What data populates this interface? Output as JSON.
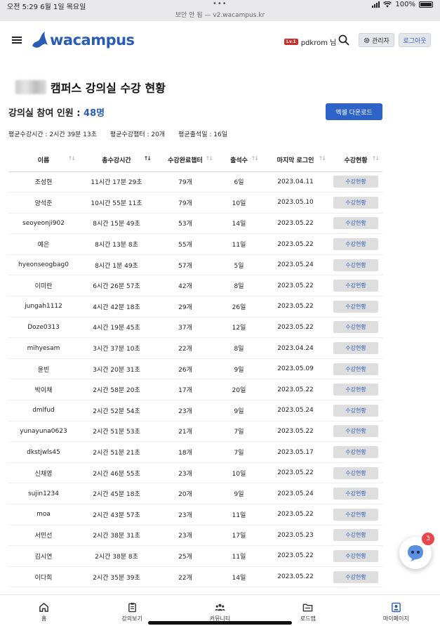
{
  "status_bar": {
    "time_date": "오전 5:29   6월 1일 목요일",
    "url": "보안 안 됨 — v2.wacampus.kr",
    "battery": "100%"
  },
  "header": {
    "logo_text": "wacampus",
    "level_badge": "Lv.1",
    "username": "pdkrom 님",
    "admin_label": "관리자",
    "logout_label": "로그아웃"
  },
  "page": {
    "title": "캠퍼스 강의실 수강 현황",
    "participants_label": "강의실 참여 인원 :",
    "participants_count": "48명",
    "excel_button": "엑셀 다운로드",
    "avg_time": "평균수강시간 : 2시간 39분 13초",
    "avg_chapters": "평균수강챕터 : 20개",
    "avg_attendance": "평균출석일 : 16일"
  },
  "table": {
    "columns": [
      "이름",
      "총수강시간",
      "수강완료챕터",
      "출석수",
      "마지막 로그인",
      "수강현황"
    ],
    "button_label": "수강현황",
    "rows": [
      [
        "조성현",
        "11시간 17분 29초",
        "79개",
        "6일",
        "2023.04.11"
      ],
      [
        "양석준",
        "10시간 55분 11초",
        "79개",
        "10일",
        "2023.05.10"
      ],
      [
        "seoyeonji902",
        "8시간 15분 49초",
        "53개",
        "14일",
        "2023.05.22"
      ],
      [
        "예은",
        "8시간 13분 8초",
        "55개",
        "11일",
        "2023.05.22"
      ],
      [
        "hyeonseogbag0",
        "8시간 1분 49초",
        "57개",
        "5일",
        "2023.05.24"
      ],
      [
        "이미란",
        "6시간 26분 57초",
        "42개",
        "8일",
        "2023.05.22"
      ],
      [
        "jungah1112",
        "4시간 42분 18초",
        "29개",
        "26일",
        "2023.05.22"
      ],
      [
        "Doze0313",
        "4시간 19분 45초",
        "37개",
        "12일",
        "2023.05.22"
      ],
      [
        "mihyesam",
        "3시간 37분 10초",
        "22개",
        "8일",
        "2023.04.24"
      ],
      [
        "윤빈",
        "3시간 20분 31초",
        "26개",
        "9일",
        "2023.05.09"
      ],
      [
        "박이채",
        "2시간 58분 20초",
        "17개",
        "20일",
        "2023.05.22"
      ],
      [
        "dmlfud",
        "2시간 52분 54초",
        "23개",
        "9일",
        "2023.05.24"
      ],
      [
        "yunayuna0623",
        "2시간 51분 53초",
        "21개",
        "7일",
        "2023.05.22"
      ],
      [
        "dkstjwls45",
        "2시간 51분 21초",
        "18개",
        "7일",
        "2023.05.17"
      ],
      [
        "신채영",
        "2시간 46분 55초",
        "23개",
        "10일",
        "2023.05.22"
      ],
      [
        "sujin1234",
        "2시간 45분 18초",
        "20개",
        "9일",
        "2023.05.24"
      ],
      [
        "moa",
        "2시간 43분 57초",
        "23개",
        "11일",
        "2023.05.22"
      ],
      [
        "서민선",
        "2시간 38분 31초",
        "23개",
        "17일",
        "2023.05.23"
      ],
      [
        "김시연",
        "2시간 38분 8초",
        "25개",
        "11일",
        "2023.05.22"
      ],
      [
        "이다희",
        "2시간 35분 39초",
        "22개",
        "14일",
        "2023.05.22"
      ]
    ]
  },
  "chat": {
    "badge": "3"
  },
  "bottom_nav": [
    {
      "label": "홈",
      "icon": "home-icon"
    },
    {
      "label": "강의보기",
      "icon": "clipboard-icon"
    },
    {
      "label": "커뮤니티",
      "icon": "people-icon"
    },
    {
      "label": "로드맵",
      "icon": "folder-icon"
    },
    {
      "label": "마이페이지",
      "icon": "profile-icon"
    }
  ],
  "colors": {
    "brand": "#2a5cb5",
    "button": "#2d62c8",
    "badge": "#e8474b"
  }
}
